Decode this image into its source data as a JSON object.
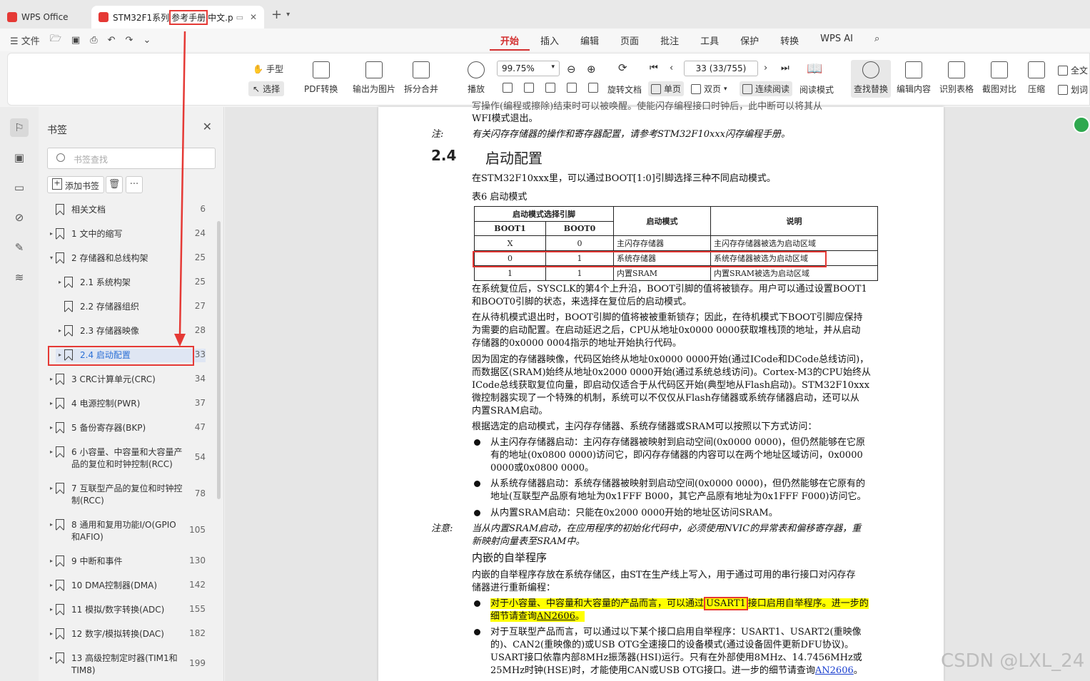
{
  "tabs": {
    "wps_label": "WPS Office",
    "doc_prefix": "STM32F1系列",
    "doc_highlight": "参考手册",
    "doc_suffix": "中文.p"
  },
  "toolbar": {
    "file_label": "文件"
  },
  "menus": [
    "开始",
    "插入",
    "编辑",
    "页面",
    "批注",
    "工具",
    "保护",
    "转换",
    "WPS AI"
  ],
  "ribbon": {
    "hand": "手型",
    "select": "选择",
    "pdf_convert": "PDF转换",
    "export_img": "输出为图片",
    "split_merge": "拆分合并",
    "play": "播放",
    "zoom": "99.75%",
    "page": "33 (33/755)",
    "rotate": "旋转文档",
    "single": "单页",
    "double": "双页",
    "continuous": "连续阅读",
    "read_mode": "阅读模式",
    "find_replace": "查找替换",
    "edit_content": "编辑内容",
    "table_recog": "识别表格",
    "screenshot_cmp": "截图对比",
    "compress": "压缩",
    "fulltext": "全文",
    "underline": "划词"
  },
  "panel": {
    "title": "书签",
    "search_placeholder": "书签查找",
    "add_bookmark": "添加书签"
  },
  "bookmarks": [
    {
      "label": "相关文档",
      "page": "6"
    },
    {
      "label": "1 文中的缩写",
      "page": "24"
    },
    {
      "label": "2 存储器和总线构架",
      "page": "25"
    },
    {
      "label": "2.1 系统构架",
      "page": "25"
    },
    {
      "label": "2.2 存储器组织",
      "page": "27"
    },
    {
      "label": "2.3 存储器映像",
      "page": "28"
    },
    {
      "label": "2.4 启动配置",
      "page": "33"
    },
    {
      "label": "3 CRC计算单元(CRC)",
      "page": "34"
    },
    {
      "label": "4 电源控制(PWR)",
      "page": "37"
    },
    {
      "label": "5 备份寄存器(BKP)",
      "page": "47"
    },
    {
      "label": "6 小容量、中容量和大容量产品的复位和时钟控制(RCC)",
      "page": "54"
    },
    {
      "label": "7 互联型产品的复位和时钟控制(RCC)",
      "page": "78"
    },
    {
      "label": "8 通用和复用功能I/O(GPIO和AFIO)",
      "page": "105"
    },
    {
      "label": "9 中断和事件",
      "page": "130"
    },
    {
      "label": "10 DMA控制器(DMA)",
      "page": "142"
    },
    {
      "label": "11 模拟/数字转换(ADC)",
      "page": "155"
    },
    {
      "label": "12 数字/模拟转换(DAC)",
      "page": "182"
    },
    {
      "label": "13 高级控制定时器(TIM1和TIM8)",
      "page": "199"
    }
  ],
  "doc": {
    "top_line1": "写操作(编程或擦除)结束时可以被唤醒。使能闪存编程接口时钟后，此中断可以将其从",
    "top_line2": "WFI模式退出。",
    "note1_label": "注:",
    "note1": "有关闪存存储器的操作和寄存器配置，请参考STM32F10xxx闪存编程手册。",
    "sec_num": "2.4",
    "sec_title": "启动配置",
    "p1": "在STM32F10xxx里，可以通过BOOT[1:0]引脚选择三种不同启动模式。",
    "table_caption": "表6      启动模式",
    "table": {
      "h_pins": "启动模式选择引脚",
      "h_mode": "启动模式",
      "h_desc": "说明",
      "h_boot1": "BOOT1",
      "h_boot0": "BOOT0",
      "rows": [
        [
          "X",
          "0",
          "主闪存存储器",
          "主闪存存储器被选为启动区域"
        ],
        [
          "0",
          "1",
          "系统存储器",
          "系统存储器被选为启动区域"
        ],
        [
          "1",
          "1",
          "内置SRAM",
          "内置SRAM被选为启动区域"
        ]
      ]
    },
    "p2a": "在系统复位后，SYSCLK的第4个上升沿，BOOT引脚的值将被锁存。用户可以通过设置BOOT1",
    "p2b": "和BOOT0引脚的状态，来选择在复位后的启动模式。",
    "p3a": "在从待机模式退出时，BOOT引脚的值将被被重新锁存；因此，在待机模式下BOOT引脚应保持",
    "p3b": "为需要的启动配置。在启动延迟之后，CPU从地址0x0000 0000获取堆栈顶的地址，并从启动",
    "p3c": "存储器的0x0000 0004指示的地址开始执行代码。",
    "p4a": "因为固定的存储器映像，代码区始终从地址0x0000 0000开始(通过ICode和DCode总线访问)，",
    "p4b": "而数据区(SRAM)始终从地址0x2000 0000开始(通过系统总线访问)。Cortex-M3的CPU始终从",
    "p4c": "ICode总线获取复位向量，即启动仅适合于从代码区开始(典型地从Flash启动)。STM32F10xxx",
    "p4d": "微控制器实现了一个特殊的机制，系统可以不仅仅从Flash存储器或系统存储器启动，还可以从",
    "p4e": "内置SRAM启动。",
    "p5": "根据选定的启动模式，主闪存存储器、系统存储器或SRAM可以按照以下方式访问：",
    "b1a": "从主闪存存储器启动：主闪存存储器被映射到启动空间(0x0000 0000)，但仍然能够在它原",
    "b1b": "有的地址(0x0800 0000)访问它，即闪存存储器的内容可以在两个地址区域访问，0x0000",
    "b1c": "0000或0x0800 0000。",
    "b2a": "从系统存储器启动：系统存储器被映射到启动空间(0x0000 0000)，但仍然能够在它原有的",
    "b2b": "地址(互联型产品原有地址为0x1FFF B000，其它产品原有地址为0x1FFF F000)访问它。",
    "b3": "从内置SRAM启动：只能在0x2000 0000开始的地址区访问SRAM。",
    "note2_label": "注意:",
    "note2a": "当从内置SRAM启动，在应用程序的初始化代码中，必须使用NVIC的异常表和偏移寄存器，重",
    "note2b": "新映射向量表至SRAM中。",
    "sub_title": "内嵌的自举程序",
    "p6a": "内嵌的自举程序存放在系统存储区，由ST在生产线上写入，用于通过可用的串行接口对闪存存",
    "p6b": "储器进行重新编程：",
    "b4a_pre": "对于小容量、中容量和大容量的产品而言，可以通过",
    "b4a_hl": "USART1",
    "b4a_post": "接口启用自举程序。进一步的",
    "b4b_pre": "细节请查询",
    "b4b_link": "AN2606",
    "b4b_post": "。",
    "b5a": "对于互联型产品而言，可以通过以下某个接口启用自举程序：USART1、USART2(重映像",
    "b5b": "的)、CAN2(重映像的)或USB OTG全速接口的设备模式(通过设备固件更新DFU协议)。",
    "b5c": "USART接口依靠内部8MHz振荡器(HSI)运行。只有在外部使用8MHz、14.7456MHz或",
    "b5d_pre": "25MHz时钟(HSE)时，才能使用CAN或USB OTG接口。进一步的细节请查询",
    "b5d_link": "AN2606",
    "b5d_post": "。"
  },
  "watermark": "CSDN @LXL_24",
  "colors": {
    "accent": "#d32f2f",
    "annotation": "#e53935",
    "highlight": "#ffff00",
    "link": "#1a3fcf"
  }
}
